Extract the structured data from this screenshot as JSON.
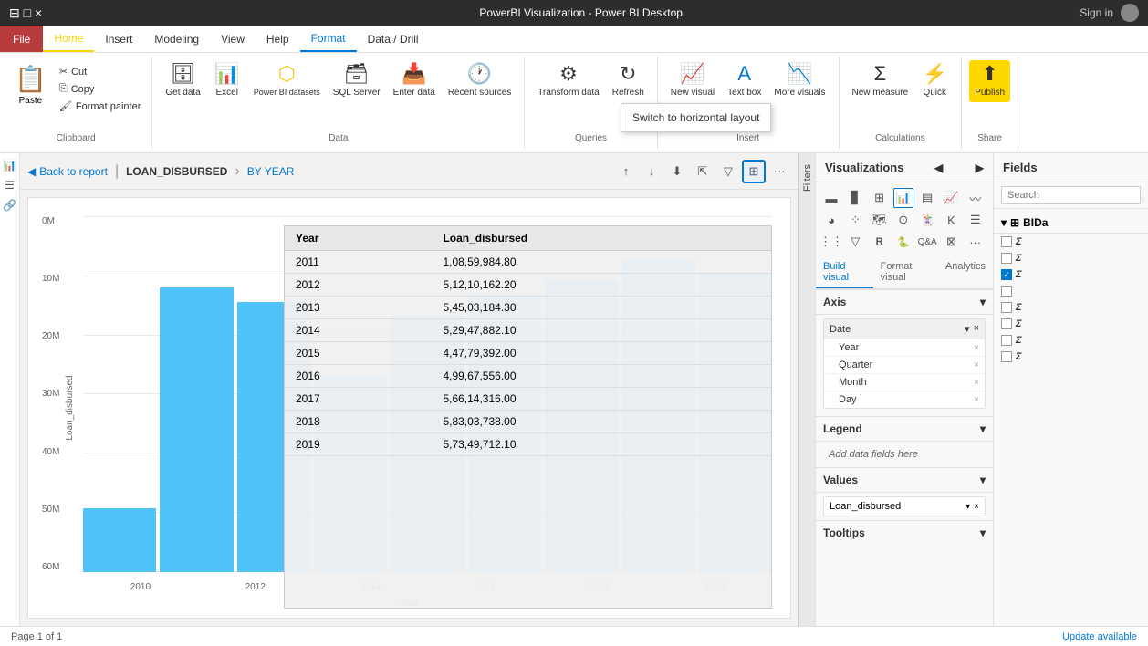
{
  "titlebar": {
    "title": "PowerBI Visualization - Power BI Desktop",
    "sign_in": "Sign in"
  },
  "menubar": {
    "items": [
      {
        "label": "File",
        "type": "file"
      },
      {
        "label": "Home",
        "type": "active"
      },
      {
        "label": "Insert",
        "type": "normal"
      },
      {
        "label": "Modeling",
        "type": "normal"
      },
      {
        "label": "View",
        "type": "normal"
      },
      {
        "label": "Help",
        "type": "normal"
      },
      {
        "label": "Format",
        "type": "format-active"
      },
      {
        "label": "Data / Drill",
        "type": "normal"
      }
    ]
  },
  "ribbon": {
    "clipboard": {
      "group_label": "Clipboard",
      "paste": "Paste",
      "cut": "Cut",
      "copy": "Copy",
      "format_painter": "Format painter"
    },
    "data": {
      "group_label": "Data",
      "get_data": "Get data",
      "excel": "Excel",
      "power_bi_datasets": "Power BI datasets",
      "sql_server": "SQL Server",
      "enter_data": "Enter data",
      "recent_sources": "Recent sources"
    },
    "queries": {
      "group_label": "Queries",
      "transform_data": "Transform data",
      "refresh": "Refresh"
    },
    "insert": {
      "group_label": "Insert",
      "new_visual": "New visual",
      "text_box": "Text box",
      "more_visuals": "More visuals"
    },
    "calculations": {
      "group_label": "Calculations",
      "new_measure": "New measure",
      "quick": "Quick"
    },
    "share": {
      "group_label": "Share",
      "publish": "Publish"
    }
  },
  "tooltip": {
    "text": "Switch to horizontal layout"
  },
  "visual_header": {
    "back": "Back to report",
    "breadcrumb1": "LOAN_DISBURSED",
    "breadcrumb2": "BY YEAR"
  },
  "chart": {
    "x_label": "Year",
    "y_label": "Loan_disbursed",
    "y_axis": [
      "0M",
      "10M",
      "20M",
      "30M",
      "40M",
      "50M",
      "60M"
    ],
    "x_axis": [
      "2010",
      "2012",
      "2014",
      "2016",
      "2018",
      "2020"
    ],
    "bars": [
      {
        "year": 2011,
        "height_pct": 18
      },
      {
        "year": 2012,
        "height_pct": 80
      },
      {
        "year": 2013,
        "height_pct": 76
      },
      {
        "year": 2014,
        "height_pct": 55
      },
      {
        "year": 2015,
        "height_pct": 72
      },
      {
        "year": 2016,
        "height_pct": 78
      },
      {
        "year": 2017,
        "height_pct": 82
      },
      {
        "year": 2018,
        "height_pct": 88
      },
      {
        "year": 2019,
        "height_pct": 84
      }
    ]
  },
  "data_table": {
    "headers": [
      "Year",
      "Loan_disbursed"
    ],
    "rows": [
      {
        "year": "2011",
        "value": "1,08,59,984.80"
      },
      {
        "year": "2012",
        "value": "5,12,10,162.20"
      },
      {
        "year": "2013",
        "value": "5,45,03,184.30"
      },
      {
        "year": "2014",
        "value": "5,29,47,882.10"
      },
      {
        "year": "2015",
        "value": "4,47,79,392.00"
      },
      {
        "year": "2016",
        "value": "4,99,67,556.00"
      },
      {
        "year": "2017",
        "value": "5,66,14,316.00"
      },
      {
        "year": "2018",
        "value": "5,83,03,738.00"
      },
      {
        "year": "2019",
        "value": "5,73,49,712.10"
      }
    ]
  },
  "visualizations": {
    "title": "Visualizations",
    "axis_section": "Axis",
    "axis_field": "Date",
    "axis_items": [
      "Year",
      "Quarter",
      "Month",
      "Day"
    ],
    "legend_section": "Legend",
    "legend_placeholder": "Add data fields here",
    "values_section": "Values",
    "values_field": "Loan_disbursed",
    "tooltips_section": "Tooltips"
  },
  "fields": {
    "title": "Fields",
    "search_placeholder": "Search",
    "table_name": "BIDa",
    "items": [
      {
        "label": "",
        "checked": false,
        "sigma": true
      },
      {
        "label": "",
        "checked": false,
        "sigma": true
      },
      {
        "label": "",
        "checked": true,
        "sigma": true
      },
      {
        "label": "",
        "checked": false,
        "sigma": false
      },
      {
        "label": "",
        "checked": false,
        "sigma": true
      },
      {
        "label": "",
        "checked": false,
        "sigma": true
      },
      {
        "label": "",
        "checked": false,
        "sigma": true
      },
      {
        "label": "",
        "checked": false,
        "sigma": true
      }
    ]
  },
  "statusbar": {
    "page": "Page 1 of 1",
    "update": "Update available"
  }
}
